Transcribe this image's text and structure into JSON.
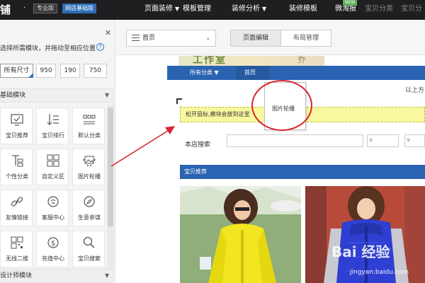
{
  "topbar": {
    "brand": "铺",
    "brand_dot": "·",
    "badge_pro": "专业版",
    "badge_version": "网店基础版",
    "nav": [
      {
        "label": "页面装修",
        "caret": "▼"
      },
      {
        "label": "模板管理"
      },
      {
        "label": "装修分析",
        "caret": "▼"
      },
      {
        "label": "装修模板"
      },
      {
        "label": "微淘报"
      },
      {
        "label": "宝贝分类"
      },
      {
        "label": "宝贝分"
      }
    ],
    "new_badge": "NEW"
  },
  "left_panel": {
    "close": "✕",
    "hint": "选择所需模块，并拖动至相应位置",
    "help": "?",
    "sizes": [
      "所有尺寸",
      "950",
      "190",
      "750"
    ],
    "section_basic": "基础模块",
    "section_caret": "▼",
    "widgets": [
      {
        "label": "宝贝推荐",
        "icon": "monitor-check-icon"
      },
      {
        "label": "宝贝排行",
        "icon": "sort-list-icon"
      },
      {
        "label": "默认分类",
        "icon": "category-grid-icon"
      },
      {
        "label": "个性分类",
        "icon": "custom-category-icon"
      },
      {
        "label": "自定义区",
        "icon": "custom-area-icon"
      },
      {
        "label": "图片轮播",
        "icon": "image-carousel-icon"
      },
      {
        "label": "友情链接",
        "icon": "link-icon"
      },
      {
        "label": "客服中心",
        "icon": "customer-service-icon"
      },
      {
        "label": "生意参谋",
        "icon": "compass-icon"
      },
      {
        "label": "无线二维",
        "icon": "qr-code-icon"
      },
      {
        "label": "充值中心",
        "icon": "dollar-icon"
      },
      {
        "label": "宝贝搜索",
        "icon": "search-icon"
      }
    ],
    "section_designer": "设计师模块"
  },
  "editor": {
    "page_select": "首页",
    "page_select_caret": "⌄",
    "tabs": [
      "页面编辑",
      "布局管理"
    ],
    "shop_banner_text": "工作室",
    "shop_banner_right": "乔",
    "shop_nav_category": "所有分类 ▼",
    "shop_nav_home": "首页",
    "right_note": "以上方",
    "dropzone_text": "松开鼠标,模块会放到这里",
    "drag_ghost_label": "图片轮播",
    "search_label": "本店搜索",
    "price_symbol": "¥",
    "recommend_title": "宝贝推荐"
  },
  "colors": {
    "topbar_bg": "#1f1f22",
    "accent_blue": "#2a63b1",
    "highlight_yellow": "#f8f8a0",
    "annotation_red": "#d9242b"
  },
  "watermark": {
    "text": "Bai 经验",
    "url": "jingyan.baidu.com"
  }
}
